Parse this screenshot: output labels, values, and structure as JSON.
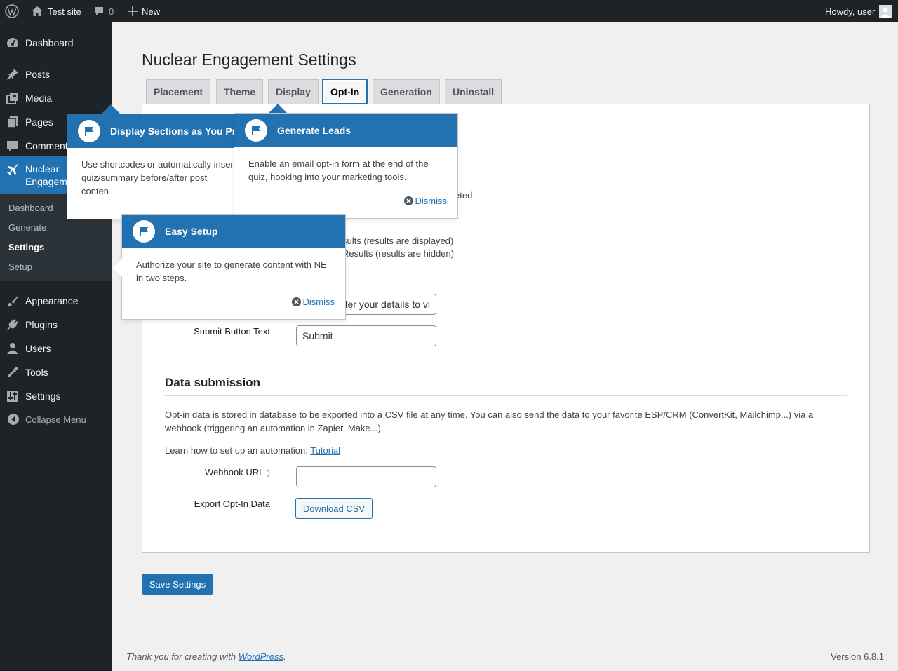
{
  "adminbar": {
    "site_name": "Test site",
    "comments_count": "0",
    "new_label": "New",
    "howdy": "Howdy, user"
  },
  "sidebar": {
    "items": [
      {
        "label": "Dashboard",
        "icon": "dashboard-icon"
      },
      {
        "label": "Posts",
        "icon": "pin-icon"
      },
      {
        "label": "Media",
        "icon": "media-icon"
      },
      {
        "label": "Pages",
        "icon": "pages-icon"
      },
      {
        "label": "Comments",
        "icon": "comment-icon"
      },
      {
        "label": "Nuclear Engagement",
        "icon": "plane-icon"
      },
      {
        "label": "Appearance",
        "icon": "brush-icon"
      },
      {
        "label": "Plugins",
        "icon": "plug-icon"
      },
      {
        "label": "Users",
        "icon": "user-icon"
      },
      {
        "label": "Tools",
        "icon": "wrench-icon"
      },
      {
        "label": "Settings",
        "icon": "sliders-icon"
      }
    ],
    "submenu": [
      "Dashboard",
      "Generate",
      "Settings",
      "Setup"
    ],
    "collapse_label": "Collapse Menu"
  },
  "page": {
    "title": "Nuclear Engagement Settings",
    "tabs": [
      "Placement",
      "Theme",
      "Display",
      "Opt-In",
      "Generation",
      "Uninstall"
    ],
    "active_tab": "Opt-In"
  },
  "optin": {
    "partial_text_completed": "eted.",
    "radio_1_partial": "sults (results are displayed)",
    "radio_2_partial": "Results (results are hidden)",
    "prompt_value_partial": "ter your details to vi",
    "submit_label": "Submit Button Text",
    "submit_value": "Submit"
  },
  "data_submission": {
    "heading": "Data submission",
    "description": "Opt-in data is stored in database to be exported into a CSV file at any time. You can also send the data to your favorite ESP/CRM (ConvertKit, Mailchimp...) via a webhook (triggering an automation in Zapier, Make...).",
    "learn_prefix": "Learn how to set up an automation:",
    "tutorial_link": "Tutorial",
    "webhook_label": "Webhook URL",
    "webhook_value": "",
    "export_label": "Export Opt-In Data",
    "download_button": "Download CSV"
  },
  "save_button": "Save Settings",
  "pointers": [
    {
      "title": "Display Sections as You Pr",
      "body": "Use shortcodes or automatically inser quiz/summary before/after post conten"
    },
    {
      "title": "Generate Leads",
      "body": "Enable an email opt-in form at the end of the quiz, hooking into your marketing tools.",
      "dismiss": "Dismiss"
    },
    {
      "title": "Easy Setup",
      "body": "Authorize your site to generate content with NE in two steps.",
      "dismiss": "Dismiss"
    }
  ],
  "footer": {
    "thanks_prefix": "Thank you for creating with",
    "wp_link": "WordPress",
    "thanks_suffix": ".",
    "version": "Version 6.8.1"
  },
  "colors": {
    "accent": "#2271b1",
    "adminbar": "#1d2327",
    "submenu": "#2c3338"
  }
}
